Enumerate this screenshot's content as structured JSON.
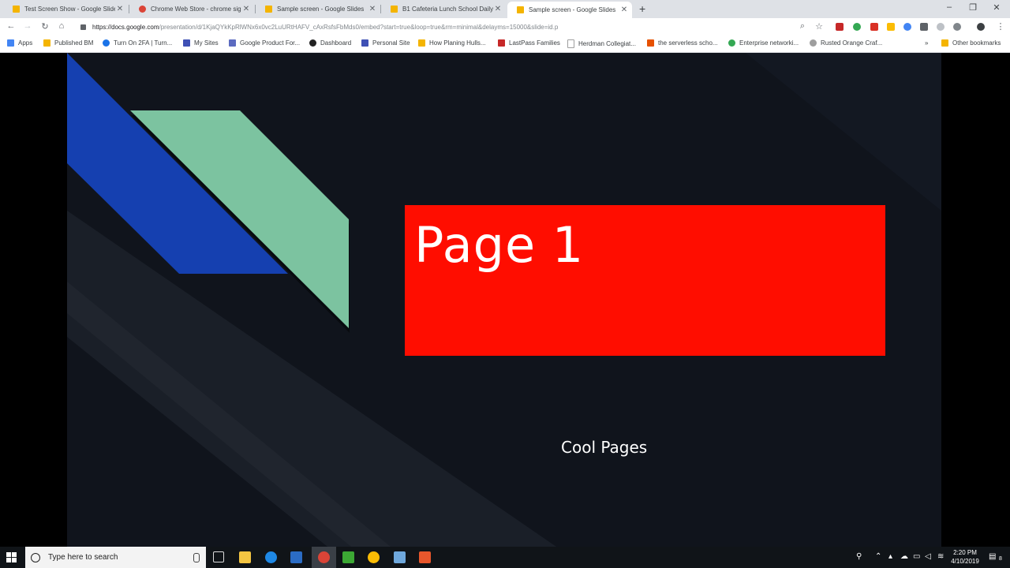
{
  "tabs": [
    {
      "title": "Test Screen Show - Google Slides",
      "fav_color": "#f4b400",
      "active": false
    },
    {
      "title": "Chrome Web Store - chrome sig",
      "fav_color": "#db4437",
      "active": false
    },
    {
      "title": "Sample screen - Google Slides",
      "fav_color": "#f4b400",
      "active": false
    },
    {
      "title": "B1 Cafeteria Lunch School Daily",
      "fav_color": "#f4b400",
      "active": false
    },
    {
      "title": "Sample screen - Google Slides",
      "fav_color": "#f4b400",
      "active": true
    }
  ],
  "omnibox": {
    "url_host": "https://docs.google.com",
    "url_path": "/presentation/d/1KjaQYkKpRlWNx6x0vc2LuURtHAFV_cAxRsfsFbMds0/embed?start=true&loop=true&rm=minimal&delayms=15000&slide=id.p"
  },
  "bookmarks": [
    {
      "label": "Apps",
      "color": "#4285f4"
    },
    {
      "label": "Published BM",
      "color": "#f4b400"
    },
    {
      "label": "Turn On 2FA | Turn...",
      "color": "#1a73e8"
    },
    {
      "label": "My Sites",
      "color": "#3f51b5"
    },
    {
      "label": "Google Product For...",
      "color": "#5c6bc0"
    },
    {
      "label": "Dashboard",
      "color": "#222"
    },
    {
      "label": "Personal Site",
      "color": "#3f51b5"
    },
    {
      "label": "How Planing Hulls...",
      "color": "#f4b400"
    },
    {
      "label": "LastPass Families",
      "color": "#c62828"
    },
    {
      "label": "Herdman Collegiat...",
      "color": "#9e9e9e"
    },
    {
      "label": "the serverless scho...",
      "color": "#e65100"
    },
    {
      "label": "Enterprise networki...",
      "color": "#34a853"
    },
    {
      "label": "Rusted Orange Craf...",
      "color": "#9e9e9e"
    },
    {
      "label": "Other bookmarks",
      "color": "#f4b400"
    }
  ],
  "slide": {
    "title": "Page 1",
    "subtitle": "Cool Pages",
    "colors": {
      "background": "#10141c",
      "title_box": "#ff0d00",
      "blue_stripe": "#1540b0",
      "green_stripe": "#7cc3a0"
    }
  },
  "taskbar": {
    "search_placeholder": "Type here to search",
    "time": "2:20 PM",
    "date": "4/10/2019",
    "notification_count": "8"
  }
}
